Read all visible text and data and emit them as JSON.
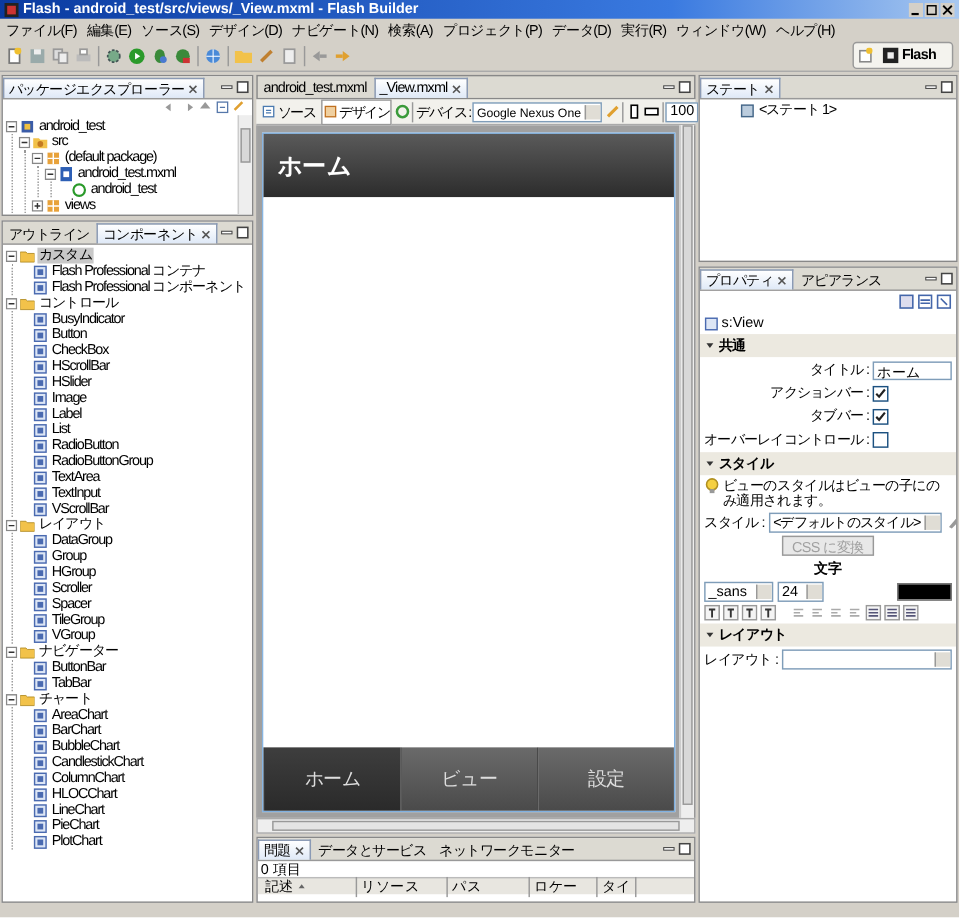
{
  "window": {
    "title": "Flash - android_test/src/views/_View.mxml - Flash Builder"
  },
  "menu": [
    "ファイル(F)",
    "編集(E)",
    "ソース(S)",
    "デザイン(D)",
    "ナビゲート(N)",
    "検索(A)",
    "プロジェクト(P)",
    "データ(D)",
    "実行(R)",
    "ウィンドウ(W)",
    "ヘルプ(H)"
  ],
  "perspective": {
    "label": "Flash"
  },
  "package_explorer": {
    "tab": {
      "label": "パッケージエクスプローラー",
      "selected": true
    },
    "tree": [
      {
        "kind": "project",
        "label": "android_test",
        "expanded": true,
        "children": [
          {
            "kind": "source-folder",
            "label": "src",
            "expanded": true,
            "children": [
              {
                "kind": "package",
                "label": "(default package)",
                "expanded": true,
                "children": [
                  {
                    "kind": "file",
                    "label": "android_test.mxml",
                    "expanded": true,
                    "children": [
                      {
                        "kind": "component",
                        "label": "android_test"
                      }
                    ]
                  }
                ]
              },
              {
                "kind": "package",
                "label": "views",
                "expanded": false
              }
            ]
          }
        ]
      }
    ]
  },
  "components_panel": {
    "tabs": [
      {
        "label": "アウトライン",
        "selected": false
      },
      {
        "label": "コンポーネント",
        "selected": true
      }
    ],
    "tree": [
      {
        "label": "カスタム",
        "expanded": true,
        "selected": true,
        "children": [
          {
            "label": "Flash Professional コンテナ",
            "selected": false
          },
          {
            "label": "Flash Professional コンポーネント",
            "selected": false
          }
        ]
      },
      {
        "label": "コントロール",
        "expanded": true,
        "selected": false,
        "children": [
          {
            "label": "BusyIndicator",
            "selected": false
          },
          {
            "label": "Button",
            "selected": false
          },
          {
            "label": "CheckBox",
            "selected": false
          },
          {
            "label": "HScrollBar",
            "selected": false
          },
          {
            "label": "HSlider",
            "selected": false
          },
          {
            "label": "Image",
            "selected": false
          },
          {
            "label": "Label",
            "selected": false
          },
          {
            "label": "List",
            "selected": false
          },
          {
            "label": "RadioButton",
            "selected": false
          },
          {
            "label": "RadioButtonGroup",
            "selected": false
          },
          {
            "label": "TextArea",
            "selected": false
          },
          {
            "label": "TextInput",
            "selected": false
          },
          {
            "label": "VScrollBar",
            "selected": false
          }
        ]
      },
      {
        "label": "レイアウト",
        "expanded": true,
        "selected": false,
        "children": [
          {
            "label": "DataGroup",
            "selected": false
          },
          {
            "label": "Group",
            "selected": false
          },
          {
            "label": "HGroup",
            "selected": false
          },
          {
            "label": "Scroller",
            "selected": false
          },
          {
            "label": "Spacer",
            "selected": false
          },
          {
            "label": "TileGroup",
            "selected": false
          },
          {
            "label": "VGroup",
            "selected": false
          }
        ]
      },
      {
        "label": "ナビゲーター",
        "expanded": true,
        "selected": false,
        "children": [
          {
            "label": "ButtonBar",
            "selected": false
          },
          {
            "label": "TabBar",
            "selected": false
          }
        ]
      },
      {
        "label": "チャート",
        "expanded": true,
        "selected": false,
        "children": [
          {
            "label": "AreaChart",
            "selected": false
          },
          {
            "label": "BarChart",
            "selected": false
          },
          {
            "label": "BubbleChart",
            "selected": false
          },
          {
            "label": "CandlestickChart",
            "selected": false
          },
          {
            "label": "ColumnChart",
            "selected": false
          },
          {
            "label": "HLOCChart",
            "selected": false
          },
          {
            "label": "LineChart",
            "selected": false
          },
          {
            "label": "PieChart",
            "selected": false
          },
          {
            "label": "PlotChart",
            "selected": false
          }
        ]
      }
    ]
  },
  "editor": {
    "tabs": [
      {
        "label": "android_test.mxml",
        "selected": false
      },
      {
        "label": "_View.mxml",
        "selected": true
      }
    ],
    "modes": [
      {
        "label": "ソース",
        "selected": false
      },
      {
        "label": "デザイン",
        "selected": true
      }
    ],
    "device_label": "デバイス :",
    "device": "Google Nexus One",
    "zoom": "100",
    "view": {
      "title": "ホーム",
      "tabs": [
        {
          "label": "ホーム",
          "selected": true
        },
        {
          "label": "ビュー",
          "selected": false
        },
        {
          "label": "設定",
          "selected": false
        }
      ]
    }
  },
  "problems_panel": {
    "tabs": [
      {
        "label": "問題",
        "selected": true
      },
      {
        "label": "データとサービス",
        "selected": false
      },
      {
        "label": "ネットワークモニター",
        "selected": false
      }
    ],
    "count": "0 項目",
    "columns": [
      "記述",
      "リソース",
      "パス",
      "ロケー",
      "タイ"
    ]
  },
  "states_panel": {
    "tab": {
      "label": "ステート",
      "selected": true
    },
    "states": [
      {
        "label": "<ステート 1>",
        "selected": false
      }
    ]
  },
  "properties_panel": {
    "tabs": [
      {
        "label": "プロパティ",
        "selected": true
      },
      {
        "label": "アピアランス",
        "selected": false
      }
    ],
    "component": "s:View",
    "common": {
      "title": "共通",
      "expanded": true,
      "fields": [
        {
          "kind": "text",
          "label": "タイトル :",
          "value": "ホーム"
        },
        {
          "kind": "checkbox",
          "label": "アクションバー :",
          "checked": true
        },
        {
          "kind": "checkbox",
          "label": "タブバー :",
          "checked": true
        },
        {
          "kind": "checkbox",
          "label": "オーバーレイコントロール :",
          "checked": false
        }
      ]
    },
    "style": {
      "title": "スタイル",
      "expanded": true,
      "tip": "ビューのスタイルはビューの子にのみ適用されます。",
      "style_label": "スタイル :",
      "style_value": "<デフォルトのスタイル>",
      "convert_button": {
        "label": "CSS に変換",
        "disabled": true
      },
      "text_heading": "文字",
      "font": "_sans",
      "size": "24"
    },
    "layout": {
      "title": "レイアウト",
      "expanded": true,
      "label": "レイアウト :"
    }
  }
}
